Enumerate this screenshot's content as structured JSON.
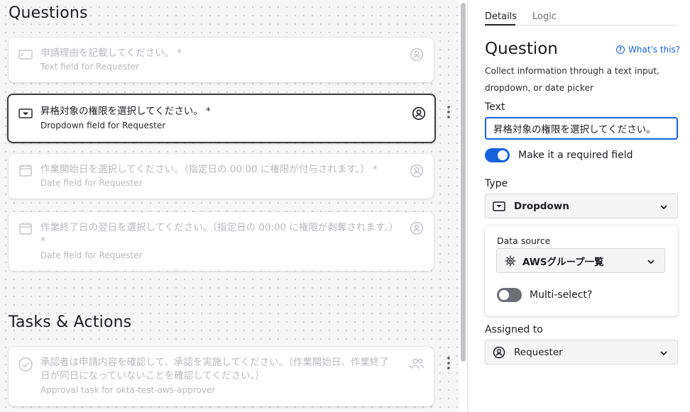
{
  "canvas": {
    "questions_title": "Questions",
    "questions": [
      {
        "text": "申請理由を記載してください。 *",
        "sub": "Text field for Requester",
        "icon": "text-field-icon"
      },
      {
        "text": "昇格対象の権限を選択してください。 *",
        "sub": "Dropdown field for Requester",
        "icon": "dropdown-field-icon"
      },
      {
        "text": "作業開始日を選択してください。（指定日の 00:00 に権限が付与されます。） *",
        "sub": "Date field for Requester",
        "icon": "calendar-icon"
      },
      {
        "text": "作業終了日の翌日を選択してください。（指定日の 00:00 に権限が剥奪されます。）",
        "text2": "*",
        "sub": "Date field for Requester",
        "icon": "calendar-icon"
      }
    ],
    "tasks_title": "Tasks & Actions",
    "tasks": [
      {
        "text": "承認者は申請内容を確認して、承認を実施してください。（作業開始日、作業終了日が同日になっていないことを確認してください。）",
        "sub": "Approval task for okta-test-aws-approver",
        "icon": "check-circle-icon"
      }
    ]
  },
  "panel": {
    "tabs": [
      "Details",
      "Logic"
    ],
    "active_tab": "Details",
    "title": "Question",
    "whats_this": "What's this?",
    "description": "Collect information through a text input, dropdown, or date picker",
    "text_label": "Text",
    "text_value": "昇格対象の権限を選択してください。",
    "required_label": "Make it a required field",
    "required_on": true,
    "type_label": "Type",
    "type_value": "Dropdown",
    "data_source_label": "Data source",
    "data_source_value": "AWSグループ一覧",
    "multiselect_label": "Multi-select?",
    "multiselect_on": false,
    "assigned_label": "Assigned to",
    "assigned_value": "Requester"
  },
  "colors": {
    "accent": "#1662dd",
    "muted_text": "#b9b9be",
    "toggle_off": "#6e6e78"
  }
}
